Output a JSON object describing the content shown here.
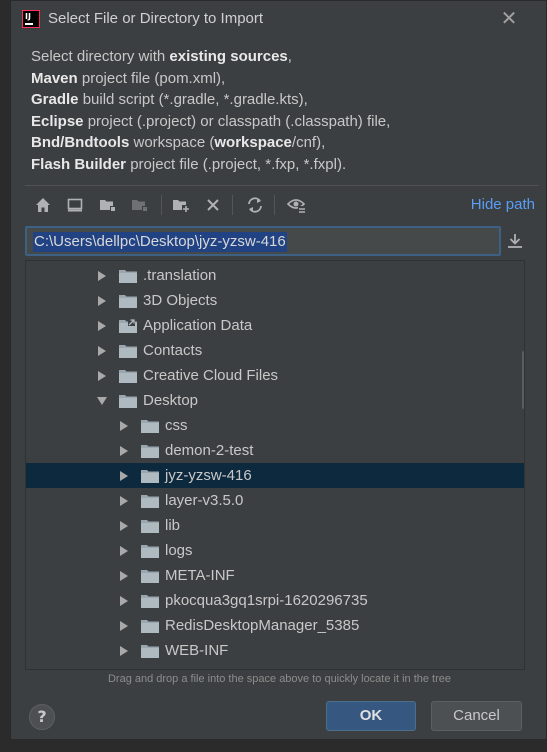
{
  "window": {
    "title": "Select File or Directory to Import",
    "close_glyph": "✕"
  },
  "description": {
    "line1_pre": "Select directory with ",
    "line1_bold": "existing sources",
    "line1_post": ",",
    "line2_bold": "Maven",
    "line2_post": " project file (pom.xml),",
    "line3_bold": "Gradle",
    "line3_post": " build script (*.gradle, *.gradle.kts),",
    "line4_bold": "Eclipse",
    "line4_post": " project (.project) or classpath (.classpath) file,",
    "line5_bold": "Bnd/Bndtools",
    "line5_mid": " workspace (",
    "line5_bold2": "workspace",
    "line5_post": "/cnf),",
    "line6_bold": "Flash Builder",
    "line6_post": " project file (.project, *.fxp, *.fxpl)."
  },
  "toolbar": {
    "icons": [
      "home-icon",
      "desktop-icon",
      "project-folder-icon",
      "module-folder-icon",
      "new-folder-icon",
      "delete-icon",
      "refresh-icon",
      "show-hidden-icon"
    ],
    "hide_path_label": "Hide path"
  },
  "path": {
    "value": "C:\\Users\\dellpc\\Desktop\\jyz-yzsw-416"
  },
  "tree": {
    "items": [
      {
        "label": ".translation",
        "level": 0,
        "expanded": false,
        "selected": false,
        "icon": "folder-icon"
      },
      {
        "label": "3D Objects",
        "level": 0,
        "expanded": false,
        "selected": false,
        "icon": "folder-icon"
      },
      {
        "label": "Application Data",
        "level": 0,
        "expanded": false,
        "selected": false,
        "icon": "folder-link-icon"
      },
      {
        "label": "Contacts",
        "level": 0,
        "expanded": false,
        "selected": false,
        "icon": "folder-icon"
      },
      {
        "label": "Creative Cloud Files",
        "level": 0,
        "expanded": false,
        "selected": false,
        "icon": "folder-icon"
      },
      {
        "label": "Desktop",
        "level": 0,
        "expanded": true,
        "selected": false,
        "icon": "folder-icon"
      },
      {
        "label": "css",
        "level": 1,
        "expanded": false,
        "selected": false,
        "icon": "folder-icon"
      },
      {
        "label": "demon-2-test",
        "level": 1,
        "expanded": false,
        "selected": false,
        "icon": "folder-icon"
      },
      {
        "label": "jyz-yzsw-416",
        "level": 1,
        "expanded": false,
        "selected": true,
        "icon": "folder-icon"
      },
      {
        "label": "layer-v3.5.0",
        "level": 1,
        "expanded": false,
        "selected": false,
        "icon": "folder-icon"
      },
      {
        "label": "lib",
        "level": 1,
        "expanded": false,
        "selected": false,
        "icon": "folder-icon"
      },
      {
        "label": "logs",
        "level": 1,
        "expanded": false,
        "selected": false,
        "icon": "folder-icon"
      },
      {
        "label": "META-INF",
        "level": 1,
        "expanded": false,
        "selected": false,
        "icon": "folder-icon"
      },
      {
        "label": "pkocqua3gq1srpi-1620296735",
        "level": 1,
        "expanded": false,
        "selected": false,
        "icon": "folder-icon"
      },
      {
        "label": "RedisDesktopManager_5385",
        "level": 1,
        "expanded": false,
        "selected": false,
        "icon": "folder-icon"
      },
      {
        "label": "WEB-INF",
        "level": 1,
        "expanded": false,
        "selected": false,
        "icon": "folder-icon"
      }
    ]
  },
  "hint": "Drag and drop a file into the space above to quickly locate it in the tree",
  "buttons": {
    "help": "?",
    "ok": "OK",
    "cancel": "Cancel"
  },
  "colors": {
    "dialog_bg": "#3c3f41",
    "accent": "#589df6",
    "selection": "#0d293e",
    "ok_button": "#365880"
  }
}
